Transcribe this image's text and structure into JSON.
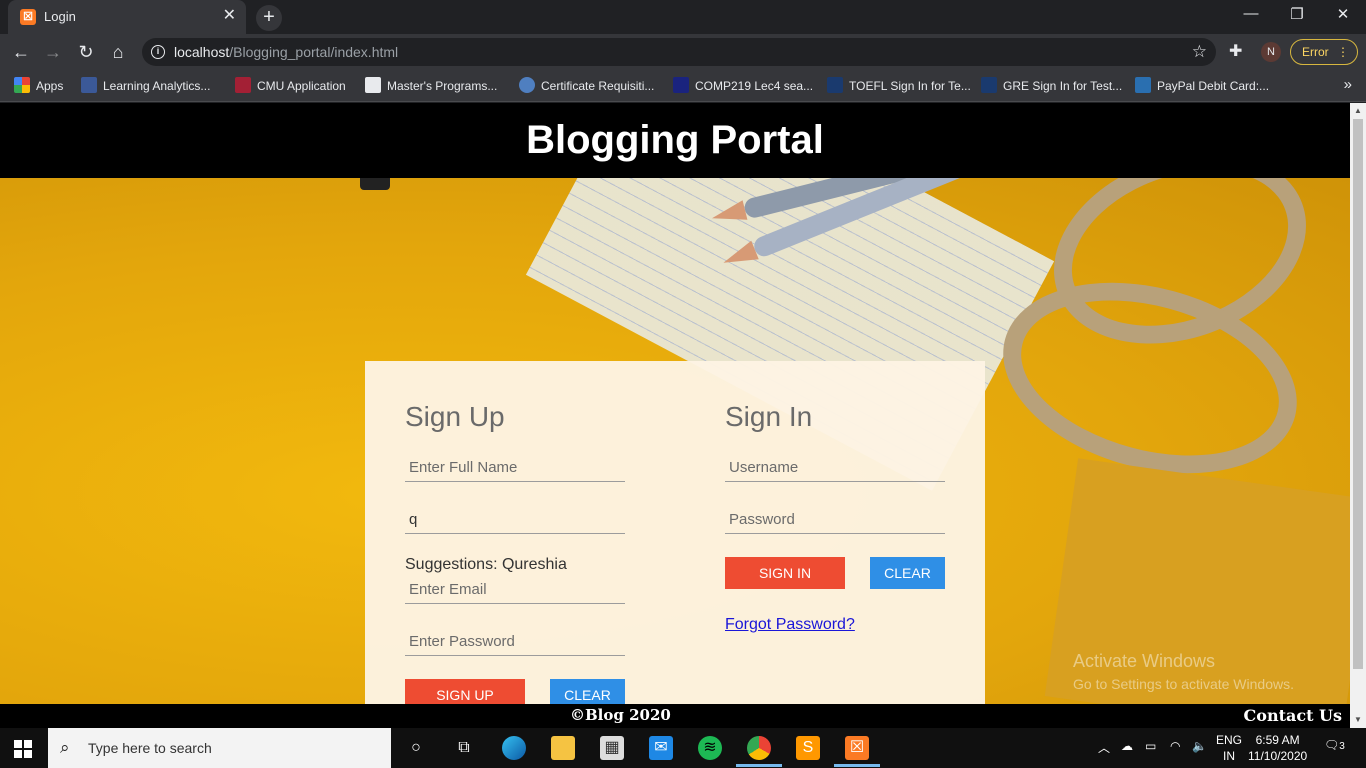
{
  "browser": {
    "tab_title": "Login",
    "url_host": "localhost",
    "url_path": "/Blogging_portal/index.html",
    "profile_initial": "N",
    "error_label": "Error",
    "bookmarks": [
      {
        "label": "Apps",
        "color": "#ea4335"
      },
      {
        "label": "Learning Analytics...",
        "color": "#3b5998"
      },
      {
        "label": "CMU Application",
        "color": "#a32035"
      },
      {
        "label": "Master's Programs...",
        "color": "#e8eaed"
      },
      {
        "label": "Certificate Requisiti...",
        "color": "#4f7fc0"
      },
      {
        "label": "COMP219 Lec4 sea...",
        "color": "#1a237e"
      },
      {
        "label": "TOEFL Sign In for Te...",
        "color": "#1a3a6e"
      },
      {
        "label": "GRE Sign In for Test...",
        "color": "#1a3a6e"
      },
      {
        "label": "PayPal Debit Card:...",
        "color": "#2a6fb0"
      }
    ]
  },
  "page": {
    "header_title": "Blogging Portal",
    "signup": {
      "heading": "Sign Up",
      "fullname_placeholder": "Enter Full Name",
      "fullname_value": "",
      "second_value": "q",
      "suggestions": "Suggestions: Qureshia",
      "email_placeholder": "Enter Email",
      "password_placeholder": "Enter Password",
      "signup_button": "SIGN UP",
      "clear_button": "CLEAR"
    },
    "signin": {
      "heading": "Sign In",
      "username_placeholder": "Username",
      "password_placeholder": "Password",
      "signin_button": "SIGN IN",
      "clear_button": "CLEAR",
      "forgot_link": "Forgot Password?"
    },
    "copyright": "©Blog 2020",
    "contact": "Contact Us",
    "watermark_title": "Activate Windows",
    "watermark_sub": "Go to Settings to activate Windows."
  },
  "taskbar": {
    "search_placeholder": "Type here to search",
    "language_line1": "ENG",
    "language_line2": "IN",
    "time": "6:59 AM",
    "date": "11/10/2020",
    "notification_count": "3"
  },
  "colors": {
    "sign_button": "#ee4c32",
    "clear_button": "#2f8fe6",
    "header_bg": "#000000",
    "background": "#e0a90f"
  }
}
